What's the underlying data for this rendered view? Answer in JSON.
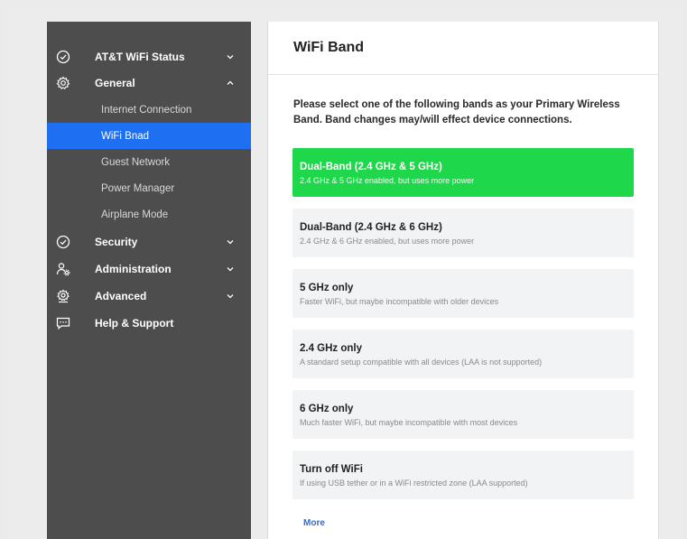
{
  "sidebar": {
    "items": [
      {
        "label": "AT&T WiFi Status",
        "icon": "check-circle-icon",
        "chevron": "down"
      },
      {
        "label": "General",
        "icon": "gear-icon",
        "chevron": "up"
      },
      {
        "label": "Security",
        "icon": "shield-check-icon",
        "chevron": "down"
      },
      {
        "label": "Administration",
        "icon": "user-gear-icon",
        "chevron": "down"
      },
      {
        "label": "Advanced",
        "icon": "advanced-gear-icon",
        "chevron": "down"
      },
      {
        "label": "Help & Support",
        "icon": "chat-icon",
        "chevron": ""
      }
    ],
    "sub_items": [
      {
        "label": "Internet Connection",
        "active": false
      },
      {
        "label": "WiFi Bnad",
        "active": true
      },
      {
        "label": "Guest Network",
        "active": false
      },
      {
        "label": "Power Manager",
        "active": false
      },
      {
        "label": "Airplane Mode",
        "active": false
      }
    ]
  },
  "main": {
    "title": "WiFi Band",
    "intro": "Please select one of the following bands as your Primary Wireless Band. Band changes may/will effect device connections.",
    "options": [
      {
        "title": "Dual-Band (2.4 GHz & 5 GHz)",
        "desc": "2.4 GHz & 5 GHz enabled, but uses more power",
        "selected": true
      },
      {
        "title": "Dual-Band (2.4 GHz & 6 GHz)",
        "desc": "2.4 GHz & 6 GHz enabled, but uses more power",
        "selected": false
      },
      {
        "title": "5 GHz only",
        "desc": "Faster WiFi, but maybe incompatible with older devices",
        "selected": false
      },
      {
        "title": "2.4 GHz only",
        "desc": "A standard setup compatible with all devices (LAA is not supported)",
        "selected": false
      },
      {
        "title": "6 GHz only",
        "desc": "Much faster WiFi, but maybe incompatible with most devices",
        "selected": false
      },
      {
        "title": "Turn off WiFi",
        "desc": "If using USB tether or in a WiFi restricted zone (LAA supported)",
        "selected": false
      }
    ],
    "more_label": "More"
  },
  "colors": {
    "sidebar_bg": "#4d4d4d",
    "active_blue": "#1f6ff3",
    "selected_green": "#1fd74b",
    "option_bg": "#f1f3f4",
    "link_blue": "#2a6fde"
  }
}
